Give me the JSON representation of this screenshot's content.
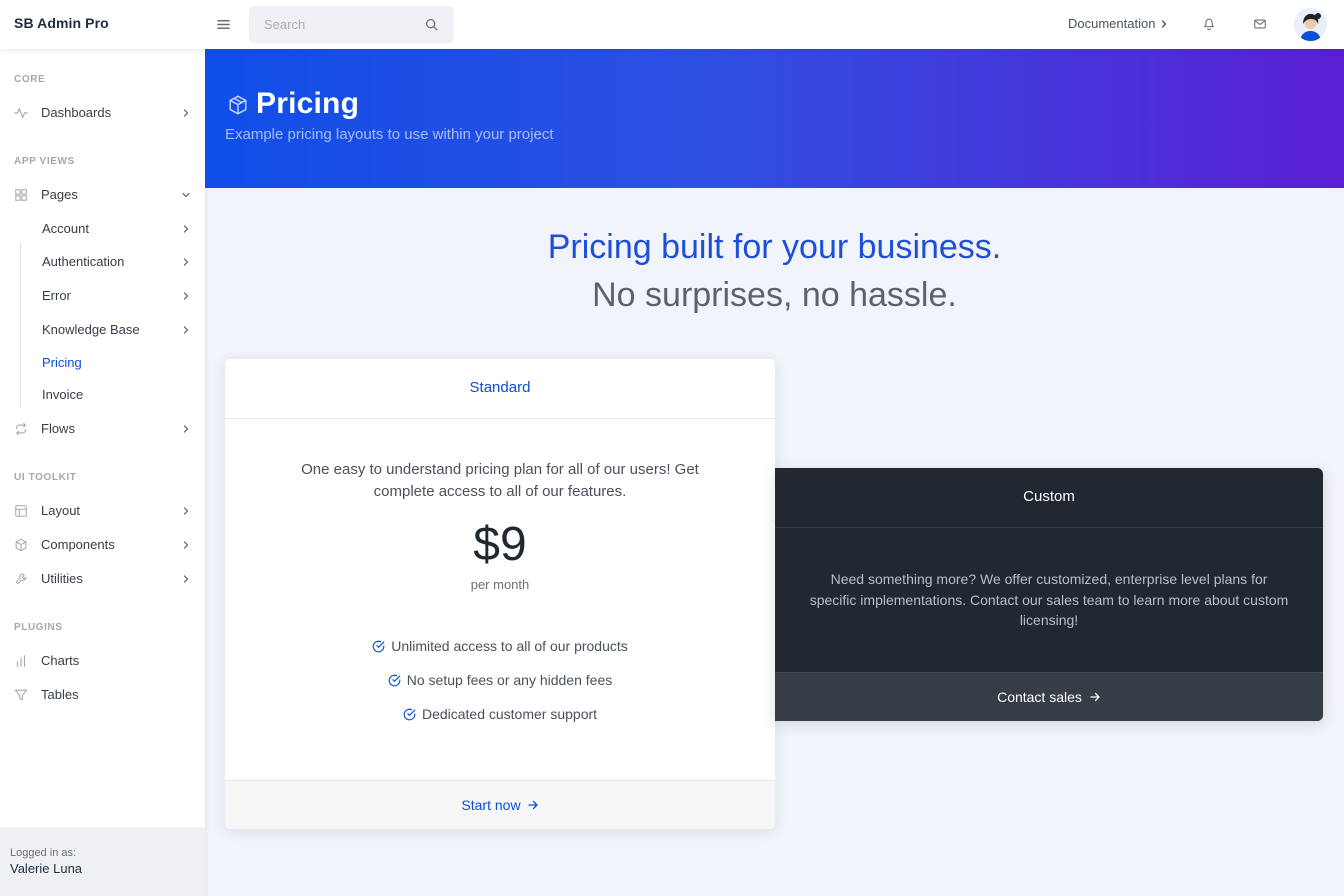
{
  "topbar": {
    "brand": "SB Admin Pro",
    "search_placeholder": "Search",
    "documentation_label": "Documentation"
  },
  "sidebar": {
    "headings": {
      "core": "CORE",
      "app_views": "APP VIEWS",
      "ui_toolkit": "UI TOOLKIT",
      "plugins": "PLUGINS"
    },
    "items": {
      "dashboards": "Dashboards",
      "pages": "Pages",
      "flows": "Flows",
      "layout": "Layout",
      "components": "Components",
      "utilities": "Utilities",
      "charts": "Charts",
      "tables": "Tables"
    },
    "pages_sub": {
      "account": "Account",
      "authentication": "Authentication",
      "error": "Error",
      "knowledge_base": "Knowledge Base",
      "pricing": "Pricing",
      "invoice": "Invoice"
    },
    "footer": {
      "label": "Logged in as:",
      "user": "Valerie Luna"
    }
  },
  "header": {
    "title": "Pricing",
    "subtitle": "Example pricing layouts to use within your project"
  },
  "headline": {
    "line1": "Pricing built for your business.",
    "line2": "No surprises, no hassle."
  },
  "standard_card": {
    "title": "Standard",
    "description": "One easy to understand pricing plan for all of our users! Get complete access to all of our features.",
    "price": "$9",
    "period": "per month",
    "features": [
      "Unlimited access to all of our products",
      "No setup fees or any hidden fees",
      "Dedicated customer support"
    ],
    "cta": "Start now"
  },
  "custom_card": {
    "title": "Custom",
    "description": "Need something more? We offer customized, enterprise level plans for specific implementations. Contact our sales team to learn more about custom licensing!",
    "cta": "Contact sales"
  },
  "colors": {
    "primary": "#0a4fd8",
    "header_gradient_start": "#0f4ee8",
    "header_gradient_end": "#5a1fd3",
    "dark_card": "#212832"
  }
}
